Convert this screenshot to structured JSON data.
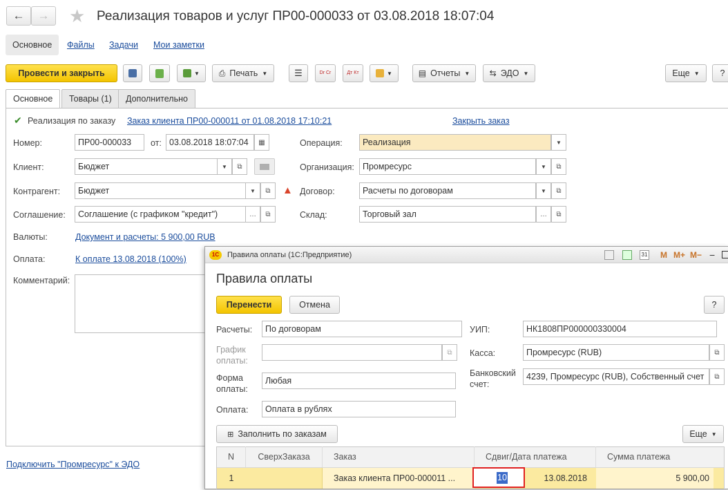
{
  "header": {
    "title": "Реализация товаров и услуг ПР00-000033 от 03.08.2018 18:07:04"
  },
  "sections": [
    "Основное",
    "Файлы",
    "Задачи",
    "Мои заметки"
  ],
  "toolbar": {
    "post_close": "Провести и закрыть",
    "print": "Печать",
    "reports": "Отчеты",
    "edo": "ЭДО",
    "more": "Еще",
    "help": "?",
    "dt_kt_1": "Dr Cr",
    "dt_kt_2": "Дт Кт"
  },
  "tabs": [
    "Основное",
    "Товары (1)",
    "Дополнительно"
  ],
  "form": {
    "by_order_label": "Реализация по заказу",
    "order_link": "Заказ клиента ПР00-000011 от 01.08.2018 17:10:21",
    "close_order_link": "Закрыть заказ",
    "number_label": "Номер:",
    "number_value": "ПР00-000033",
    "from_label": "от:",
    "date_value": "03.08.2018 18:07:04",
    "operation_label": "Операция:",
    "operation_value": "Реализация",
    "client_label": "Клиент:",
    "client_value": "Бюджет",
    "org_label": "Организация:",
    "org_value": "Промресурс",
    "counterparty_label": "Контрагент:",
    "counterparty_value": "Бюджет",
    "contract_label": "Договор:",
    "contract_value": "Расчеты по договорам",
    "agreement_label": "Соглашение:",
    "agreement_value": "Соглашение (с графиком \"кредит\")",
    "warehouse_label": "Склад:",
    "warehouse_value": "Торговый зал",
    "currency_label": "Валюты:",
    "currency_link": "Документ и расчеты: 5 900,00 RUB",
    "payment_label": "Оплата:",
    "payment_link": "К оплате 13.08.2018 (100%)",
    "comment_label": "Комментарий:",
    "edo_link": "Подключить \"Промресурс\" к ЭДО"
  },
  "dialog": {
    "window_title": "Правила оплаты  (1С:Предприятие)",
    "heading": "Правила оплаты",
    "transfer": "Перенести",
    "cancel": "Отмена",
    "help": "?",
    "mem_m": "M",
    "mem_mplus": "M+",
    "mem_mminus": "M−",
    "settlements_label": "Расчеты:",
    "settlements_value": "По договорам",
    "schedule_label_1": "График",
    "schedule_label_2": "оплаты:",
    "schedule_value": "",
    "form_label_1": "Форма",
    "form_label_2": "оплаты:",
    "form_value": "Любая",
    "payment_label": "Оплата:",
    "payment_value": "Оплата в рублях",
    "uip_label": "УИП:",
    "uip_value": "НК1808ПР000000330004",
    "cash_label": "Касса:",
    "cash_value": "Промресурс (RUB)",
    "bank_label_1": "Банковский",
    "bank_label_2": "счет:",
    "bank_value": "4239, Промресурс (RUB), Собственный счет",
    "fill_button": "Заполнить по заказам",
    "more": "Еще",
    "columns": [
      "N",
      "СверхЗаказа",
      "Заказ",
      "Сдвиг/Дата платежа",
      "Сумма платежа"
    ],
    "row": {
      "n": "1",
      "over": "",
      "order": "Заказ клиента ПР00-000011 ...",
      "shift": "10",
      "date": "13.08.2018",
      "sum": "5 900,00"
    }
  },
  "colors": {
    "accent_yellow": "#f5c900",
    "link": "#1a4c9c",
    "row_highlight": "#fbeaa0",
    "warning": "#d9442b"
  }
}
